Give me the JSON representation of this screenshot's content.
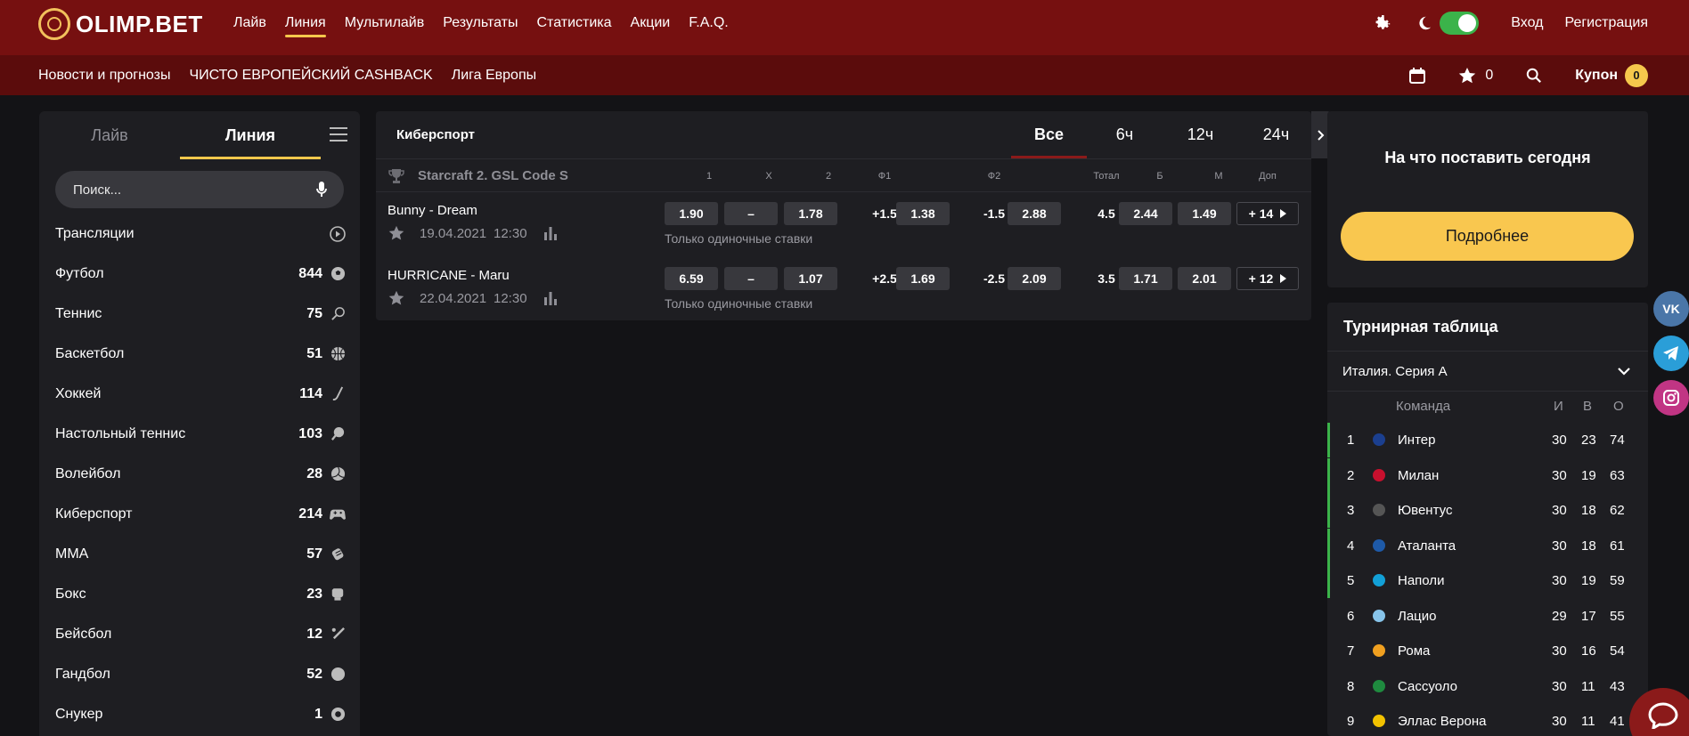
{
  "brand": {
    "name": "OLIMP.BET",
    "accent": "#f5c84c",
    "header_bg": "#761010"
  },
  "topnav": [
    "Лайв",
    "Линия",
    "Мультилайв",
    "Результаты",
    "Статистика",
    "Акции",
    "F.A.Q."
  ],
  "auth": {
    "login": "Вход",
    "register": "Регистрация"
  },
  "subnav": [
    "Новости и прогнозы",
    "ЧИСТО ЕВРОПЕЙСКИЙ CASHBACK",
    "Лига Европы"
  ],
  "favorites_count": "0",
  "coupon": {
    "label": "Купон",
    "count": "0"
  },
  "left": {
    "tabs": [
      "Лайв",
      "Линия"
    ],
    "search_placeholder": "Поиск...",
    "sports": [
      {
        "name": "Трансляции",
        "count": "",
        "icon": "play-icon"
      },
      {
        "name": "Футбол",
        "count": "844",
        "icon": "football-icon"
      },
      {
        "name": "Теннис",
        "count": "75",
        "icon": "tennis-icon"
      },
      {
        "name": "Баскетбол",
        "count": "51",
        "icon": "basketball-icon"
      },
      {
        "name": "Хоккей",
        "count": "114",
        "icon": "hockey-icon"
      },
      {
        "name": "Настольный теннис",
        "count": "103",
        "icon": "table-tennis-icon"
      },
      {
        "name": "Волейбол",
        "count": "28",
        "icon": "volleyball-icon"
      },
      {
        "name": "Киберспорт",
        "count": "214",
        "icon": "gamepad-icon"
      },
      {
        "name": "MMA",
        "count": "57",
        "icon": "mma-icon"
      },
      {
        "name": "Бокс",
        "count": "23",
        "icon": "boxing-icon"
      },
      {
        "name": "Бейсбол",
        "count": "12",
        "icon": "baseball-icon"
      },
      {
        "name": "Гандбол",
        "count": "52",
        "icon": "handball-icon"
      },
      {
        "name": "Снукер",
        "count": "1",
        "icon": "snooker-icon"
      }
    ]
  },
  "center": {
    "category": "Киберспорт",
    "time_tabs": [
      "Все",
      "6ч",
      "12ч",
      "24ч"
    ],
    "league": "Starcraft 2. GSL Code S",
    "columns": [
      "1",
      "X",
      "2",
      "Ф1",
      "Ф2",
      "Тотал",
      "Б",
      "М",
      "Доп"
    ],
    "matches": [
      {
        "teams": "Bunny - Dream",
        "date": "19.04.2021",
        "time": "12:30",
        "odds": {
          "w1": "1.90",
          "x": "–",
          "w2": "1.78",
          "f1_line": "+1.5",
          "f1": "1.38",
          "f2_line": "-1.5",
          "f2": "2.88",
          "total": "4.5",
          "over": "2.44",
          "under": "1.49"
        },
        "more": "+ 14",
        "note": "Только одиночные ставки"
      },
      {
        "teams": "HURRICANE - Maru",
        "date": "22.04.2021",
        "time": "12:30",
        "odds": {
          "w1": "6.59",
          "x": "–",
          "w2": "1.07",
          "f1_line": "+2.5",
          "f1": "1.69",
          "f2_line": "-2.5",
          "f2": "2.09",
          "total": "3.5",
          "over": "1.71",
          "under": "2.01"
        },
        "more": "+ 12",
        "note": "Только одиночные ставки"
      }
    ]
  },
  "promo": {
    "title": "На что поставить сегодня",
    "button": "Подробнее"
  },
  "standings": {
    "title": "Турнирная таблица",
    "league": "Италия. Серия A",
    "headers": {
      "team": "Команда",
      "played": "И",
      "won": "В",
      "points": "О"
    },
    "rows": [
      {
        "pos": "1",
        "team": "Интер",
        "played": "30",
        "won": "23",
        "points": "74",
        "color": "#1b3f8f"
      },
      {
        "pos": "2",
        "team": "Милан",
        "played": "30",
        "won": "19",
        "points": "63",
        "color": "#c8102e"
      },
      {
        "pos": "3",
        "team": "Ювентус",
        "played": "30",
        "won": "18",
        "points": "62",
        "color": "#555555"
      },
      {
        "pos": "4",
        "team": "Аталанта",
        "played": "30",
        "won": "18",
        "points": "61",
        "color": "#1e5aa8"
      },
      {
        "pos": "5",
        "team": "Наполи",
        "played": "30",
        "won": "19",
        "points": "59",
        "color": "#12a0d7"
      },
      {
        "pos": "6",
        "team": "Лацио",
        "played": "29",
        "won": "17",
        "points": "55",
        "color": "#87c4ea"
      },
      {
        "pos": "7",
        "team": "Рома",
        "played": "30",
        "won": "16",
        "points": "54",
        "color": "#f0a020"
      },
      {
        "pos": "8",
        "team": "Сассуоло",
        "played": "30",
        "won": "11",
        "points": "43",
        "color": "#1f8a3f"
      },
      {
        "pos": "9",
        "team": "Эллас Верона",
        "played": "30",
        "won": "11",
        "points": "41",
        "color": "#f2c200"
      }
    ]
  },
  "social": [
    {
      "name": "vk-icon",
      "label": "VK",
      "color": "#4a76a8"
    },
    {
      "name": "telegram-icon",
      "label": "",
      "color": "#2a9ed8"
    },
    {
      "name": "instagram-icon",
      "label": "",
      "color": "#c13584"
    }
  ]
}
